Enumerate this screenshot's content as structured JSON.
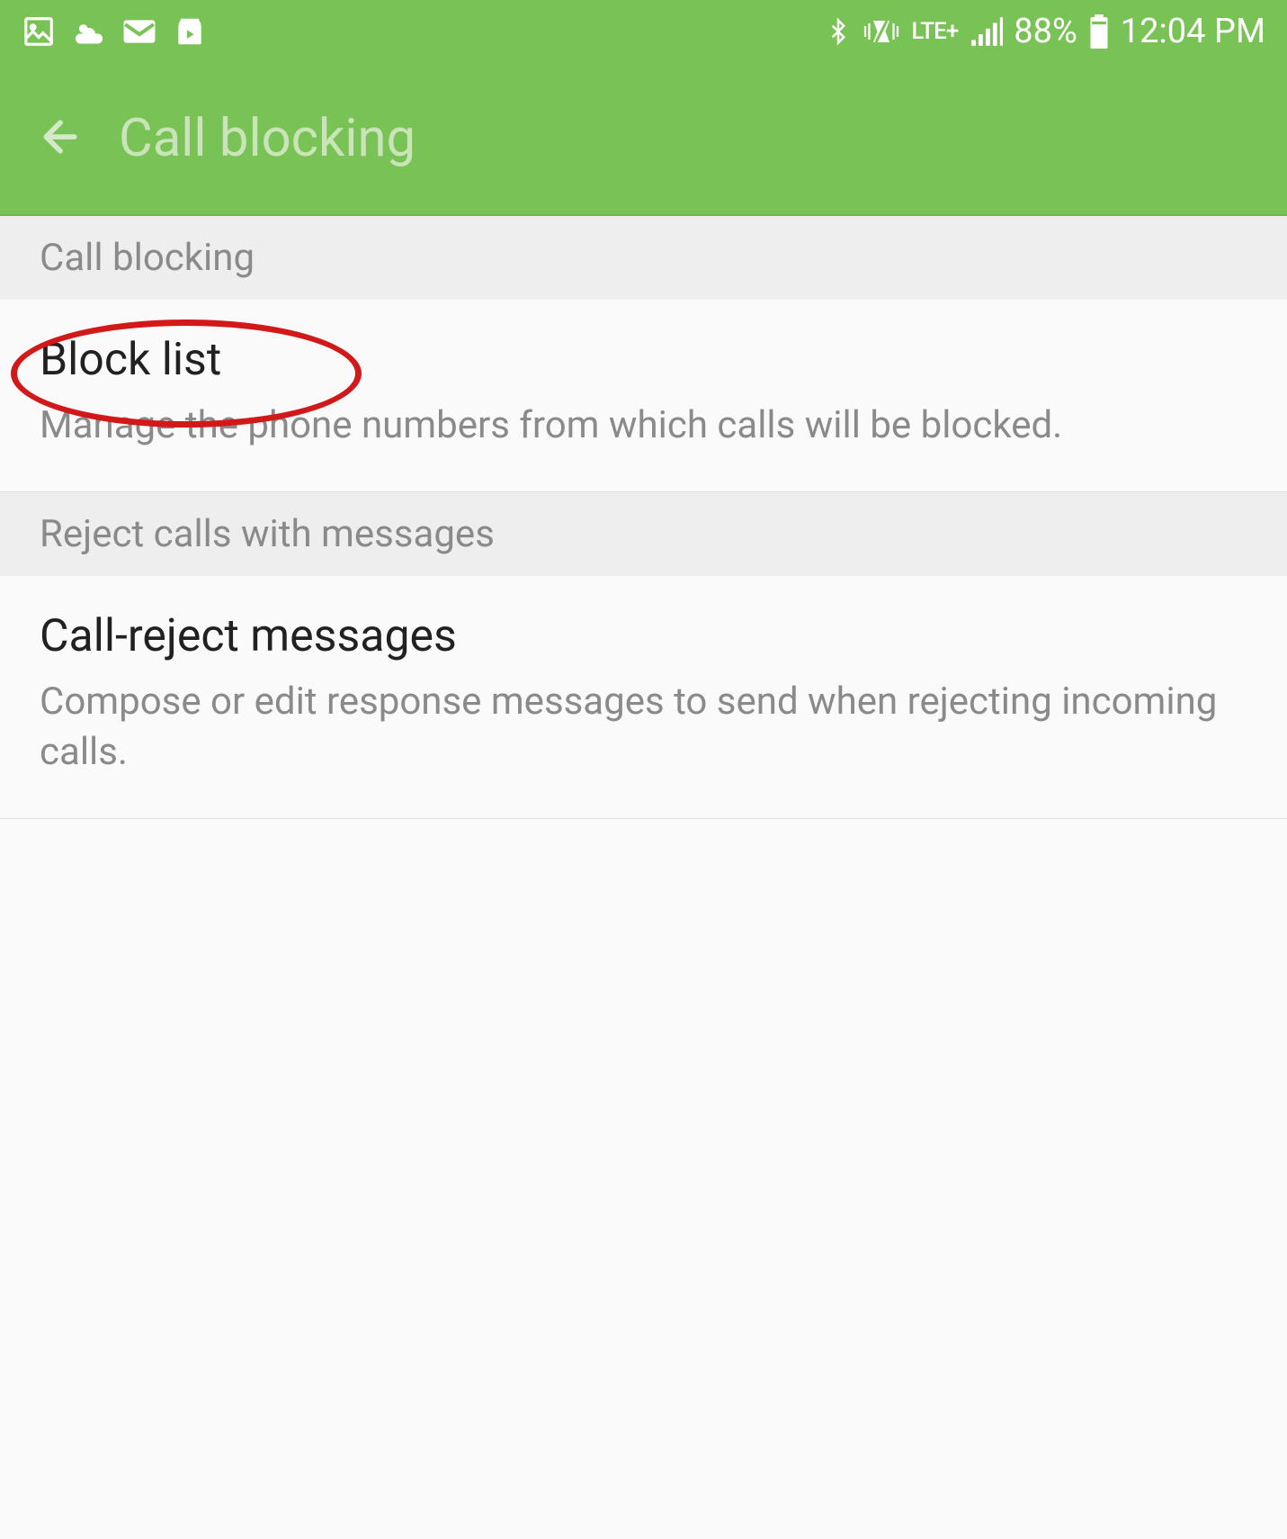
{
  "statusBar": {
    "batteryPercent": "88%",
    "time": "12:04 PM",
    "network": "LTE+"
  },
  "header": {
    "title": "Call blocking"
  },
  "sections": [
    {
      "header": "Call blocking",
      "items": [
        {
          "title": "Block list",
          "description": "Manage the phone numbers from which calls will be blocked.",
          "annotated": true
        }
      ]
    },
    {
      "header": "Reject calls with messages",
      "items": [
        {
          "title": "Call-reject messages",
          "description": "Compose or edit response messages to send when rejecting incoming calls."
        }
      ]
    }
  ]
}
